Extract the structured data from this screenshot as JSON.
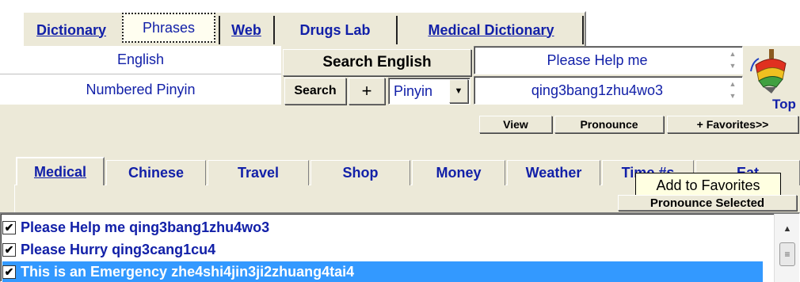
{
  "menu": {
    "dictionary": "Dictionary",
    "phrases": "Phrases",
    "web": "Web",
    "drugs_lab": "Drugs Lab",
    "medical_dictionary": "Medical Dictionary"
  },
  "language": {
    "source": "English",
    "target": "Numbered Pinyin"
  },
  "search": {
    "main_button": "Search English",
    "search_button": "Search",
    "plus_button": "+",
    "mode_select": "Pinyin"
  },
  "results": {
    "english": "Please Help me",
    "pinyin": "qing3bang1zhu4wo3"
  },
  "top_label": "Top",
  "actions": {
    "view": "View",
    "pronounce": "Pronounce",
    "favorites": "+ Favorites>>"
  },
  "tabs": [
    "Medical",
    "Chinese",
    "Travel",
    "Shop",
    "Money",
    "Weather",
    "Time #s",
    "Eat"
  ],
  "tooltip": "Add to Favorites",
  "pronounce_selected": "Pronounce Selected",
  "phrases_list": [
    {
      "text": "Please Help me qing3bang1zhu4wo3",
      "checked": true,
      "selected": false
    },
    {
      "text": "Please Hurry qing3cang1cu4",
      "checked": true,
      "selected": false
    },
    {
      "text": "This is an Emergency zhe4shi4jin3ji2zhuang4tai4",
      "checked": true,
      "selected": true
    }
  ],
  "colors": {
    "link_blue": "#1220a8",
    "selection_blue": "#3399ff",
    "window_gray": "#ece9d8"
  }
}
